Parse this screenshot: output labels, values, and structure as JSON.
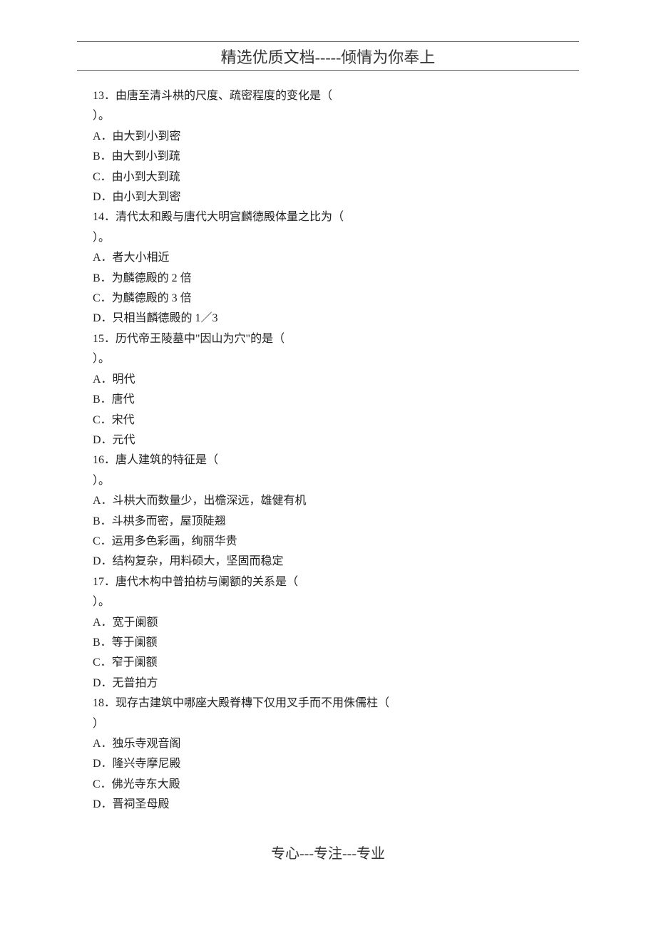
{
  "header": {
    "title": "精选优质文档-----倾情为你奉上"
  },
  "footer": {
    "text": "专心---专注---专业"
  },
  "questions": [
    {
      "stem_line1": "13．由唐至清斗栱的尺度、疏密程度的变化是（",
      "stem_line2": "）。",
      "options": [
        "A．由大到小到密",
        "B．由大到小到疏",
        "C．由小到大到疏",
        "D．由小到大到密"
      ]
    },
    {
      "stem_line1": "14．清代太和殿与唐代大明宫麟德殿体量之比为（",
      "stem_line2": "）。",
      "options": [
        "A．者大小相近",
        "B．为麟德殿的 2 倍",
        "C．为麟德殿的 3 倍",
        "D．只相当麟德殿的 1／3"
      ]
    },
    {
      "stem_line1": "15．历代帝王陵墓中\"因山为穴\"的是（",
      "stem_line2": "）。",
      "options": [
        "A．明代",
        "B．唐代",
        "C．宋代",
        "D．元代"
      ]
    },
    {
      "stem_line1": "16．唐人建筑的特征是（",
      "stem_line2": "）。",
      "options": [
        "A．斗栱大而数量少，出檐深远，雄健有机",
        "B．斗栱多而密，屋顶陡翘",
        "C．运用多色彩画，绚丽华贵",
        "D．结构复杂，用料硕大，坚固而稳定"
      ]
    },
    {
      "stem_line1": "17．唐代木构中普拍枋与阑额的关系是（",
      "stem_line2": "）。",
      "options": [
        "A．宽于阑额",
        "B．等于阑额",
        "C．窄于阑额",
        "D．无普拍方"
      ]
    },
    {
      "stem_line1": "18．现存古建筑中哪座大殿脊槫下仅用叉手而不用侏儒柱（",
      "stem_line2": "）",
      "options": [
        "A．独乐寺观音阁",
        "D．隆兴寺摩尼殿",
        "C．佛光寺东大殿",
        "D．晋祠圣母殿"
      ]
    }
  ]
}
